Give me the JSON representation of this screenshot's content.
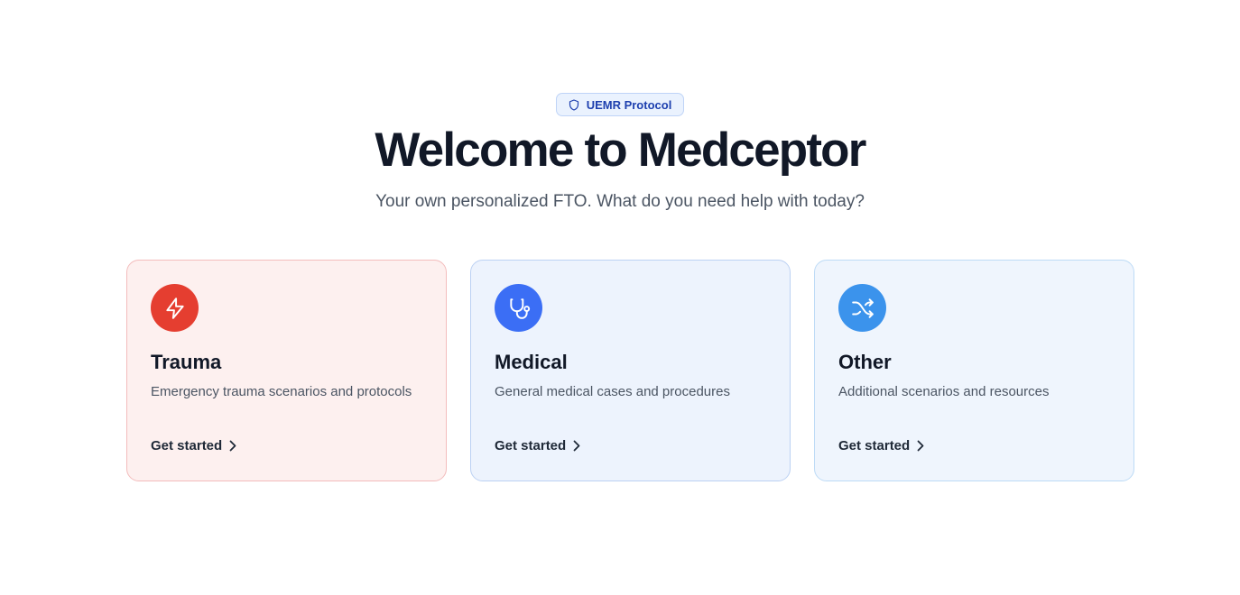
{
  "badge": {
    "icon": "shield-icon",
    "label": "UEMR Protocol"
  },
  "hero": {
    "title": "Welcome to Medceptor",
    "subtitle": "Your own personalized FTO. What do you need help with today?"
  },
  "cards": [
    {
      "icon": "lightning-icon",
      "icon_color": "#e53e30",
      "background": "#fdf0ef",
      "border": "#f3bcbc",
      "title": "Trauma",
      "description": "Emergency trauma scenarios and protocols",
      "cta": "Get started"
    },
    {
      "icon": "stethoscope-icon",
      "icon_color": "#3b6ef5",
      "background": "#edf3fd",
      "border": "#bcd1f3",
      "title": "Medical",
      "description": "General medical cases and procedures",
      "cta": "Get started"
    },
    {
      "icon": "shuffle-icon",
      "icon_color": "#3b93ec",
      "background": "#eff5fd",
      "border": "#bddbf6",
      "title": "Other",
      "description": "Additional scenarios and resources",
      "cta": "Get started"
    }
  ]
}
